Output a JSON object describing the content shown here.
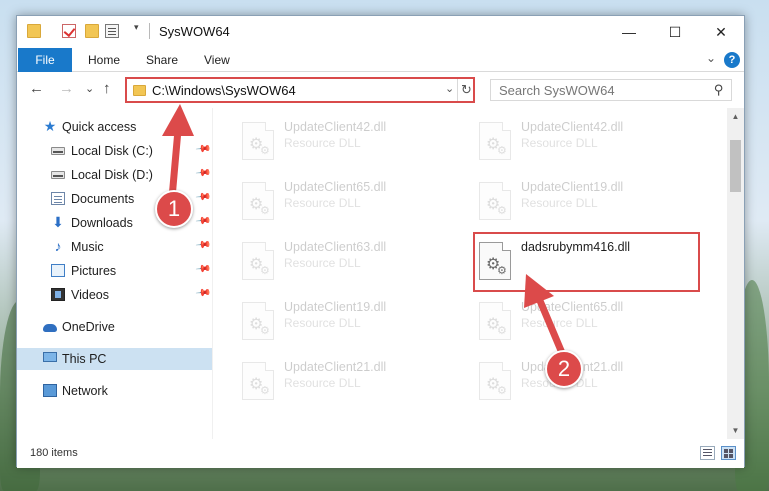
{
  "window": {
    "title": "SysWOW64",
    "controls": {
      "minimize": "—",
      "maximize": "☐",
      "close": "✕"
    }
  },
  "ribbon": {
    "tabs": [
      "File",
      "Home",
      "Share",
      "View"
    ],
    "expand_glyph": "⌄",
    "help_glyph": "?"
  },
  "address_bar": {
    "path": "C:\\Windows\\SysWOW64",
    "dropdown_glyph": "⌄",
    "refresh_glyph": "↻"
  },
  "search": {
    "placeholder": "Search SysWOW64",
    "icon_glyph": "⚲"
  },
  "nav_buttons": {
    "back": "←",
    "forward": "→",
    "recent": "⌄",
    "up": "↑"
  },
  "nav_pane": {
    "items": [
      {
        "label": "Quick access",
        "icon": "star-icon",
        "pinned": false
      },
      {
        "label": "Local Disk (C:)",
        "icon": "drive-icon",
        "pinned": true
      },
      {
        "label": "Local Disk (D:)",
        "icon": "drive-icon",
        "pinned": true
      },
      {
        "label": "Documents",
        "icon": "documents-icon",
        "pinned": true
      },
      {
        "label": "Downloads",
        "icon": "downloads-icon",
        "pinned": true
      },
      {
        "label": "Music",
        "icon": "music-icon",
        "pinned": true
      },
      {
        "label": "Pictures",
        "icon": "pictures-icon",
        "pinned": true
      },
      {
        "label": "Videos",
        "icon": "videos-icon",
        "pinned": true
      },
      {
        "label": "OneDrive",
        "icon": "onedrive-icon",
        "pinned": false
      },
      {
        "label": "This PC",
        "icon": "computer-icon",
        "pinned": false,
        "selected": true
      },
      {
        "label": "Network",
        "icon": "network-icon",
        "pinned": false
      }
    ],
    "pin_glyph": "📌"
  },
  "files": [
    {
      "name": "UpdateClient42.dll",
      "type": "Resource DLL",
      "faded": true
    },
    {
      "name": "UpdateClient42.dll",
      "type": "Resource DLL",
      "faded": true
    },
    {
      "name": "UpdateClient65.dll",
      "type": "Resource DLL",
      "faded": true
    },
    {
      "name": "UpdateClient19.dll",
      "type": "Resource DLL",
      "faded": true
    },
    {
      "name": "UpdateClient63.dll",
      "type": "Resource DLL",
      "faded": true
    },
    {
      "name": "dadsrubymm416.dll",
      "type": "",
      "faded": false,
      "highlighted": true
    },
    {
      "name": "UpdateClient19.dll",
      "type": "Resource DLL",
      "faded": true
    },
    {
      "name": "UpdateClient65.dll",
      "type": "Resource DLL",
      "faded": true
    },
    {
      "name": "UpdateClient21.dll",
      "type": "Resource DLL",
      "faded": true
    },
    {
      "name": "UpdateClient21.dll",
      "type": "Resource DLL",
      "faded": true
    }
  ],
  "status_bar": {
    "item_count": "180 items"
  },
  "scrollbar": {
    "up_glyph": "▲",
    "down_glyph": "▼"
  },
  "callouts": [
    {
      "number": "1",
      "color": "#dc4a4a"
    },
    {
      "number": "2",
      "color": "#dc4a4a"
    }
  ],
  "colors": {
    "accent": "#1979ca",
    "highlight_red": "#d94b4b",
    "selection": "#cce1f2"
  }
}
